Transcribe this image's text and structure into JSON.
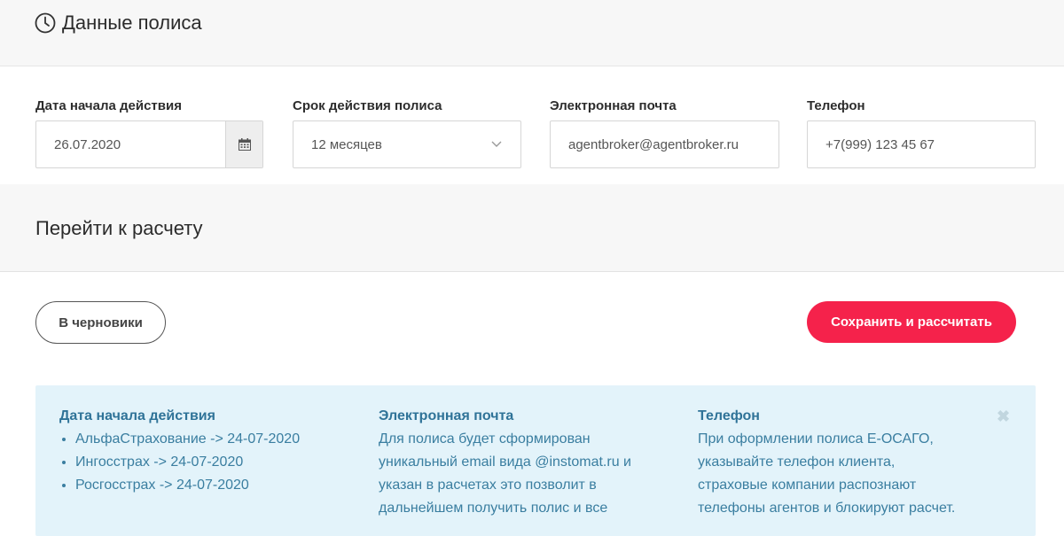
{
  "policy_section": {
    "title": "Данные полиса"
  },
  "fields": {
    "start_date": {
      "label": "Дата начала действия",
      "value": "26.07.2020"
    },
    "term": {
      "label": "Срок действия полиса",
      "value": "12 месяцев"
    },
    "email": {
      "label": "Электронная почта",
      "value": "agentbroker@agentbroker.ru"
    },
    "phone": {
      "label": "Телефон",
      "value": "+7(999) 123 45 67"
    }
  },
  "calc_section": {
    "title": "Перейти к расчету"
  },
  "actions": {
    "draft_label": "В черновики",
    "save_label": "Сохранить и рассчитать"
  },
  "info": {
    "start_date": {
      "title": "Дата начала действия",
      "items": [
        "АльфаСтрахование -> 24-07-2020",
        "Ингосстрах -> 24-07-2020",
        "Росгосстрах -> 24-07-2020"
      ]
    },
    "email": {
      "title": "Электронная почта",
      "lines": [
        "Для полиса будет сформирован",
        "уникальный email вида @instomat.ru и",
        "указан в расчетах это позволит в",
        "дальнейшем получить полис и все"
      ]
    },
    "phone": {
      "title": "Телефон",
      "lines": [
        "При оформлении полиса Е-ОСАГО,",
        "указывайте телефон клиента,",
        "страховые компании распознают",
        "телефоны агентов и блокируют расчет."
      ]
    },
    "close_symbol": "✖"
  },
  "colors": {
    "accent": "#f5224b",
    "info_bg": "#e3f3fa",
    "info_text": "#3a7ea0"
  }
}
